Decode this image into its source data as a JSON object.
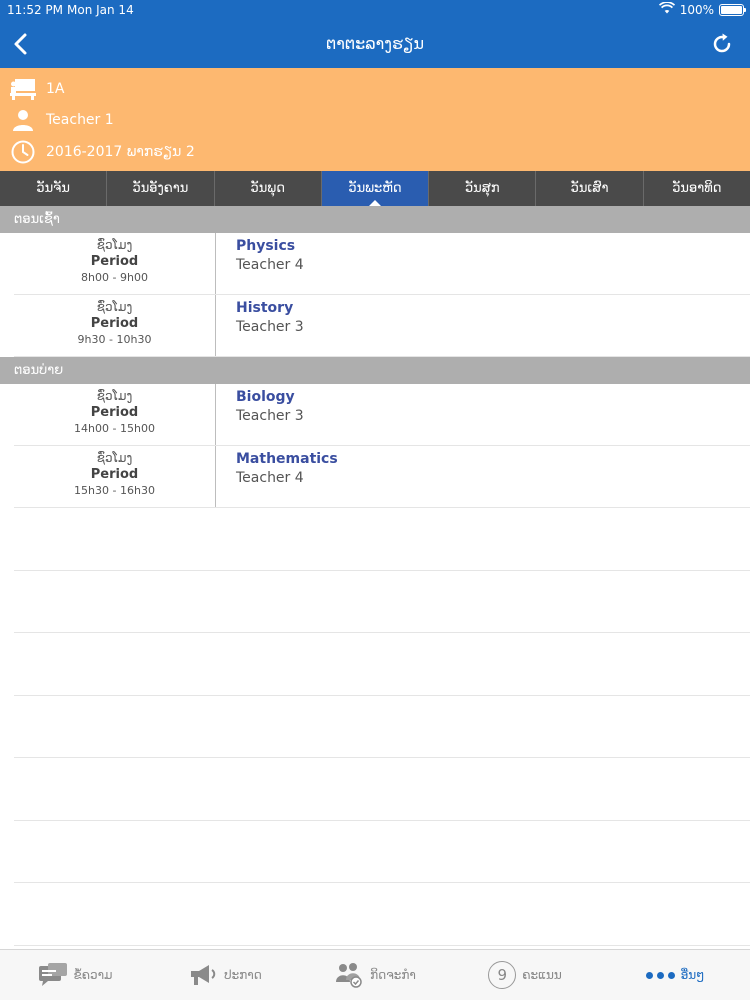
{
  "status_bar": {
    "time": "11:52 PM",
    "date": "Mon Jan 14",
    "battery": "100%"
  },
  "navbar": {
    "title": "ຕາຕະລາງຮຽນ"
  },
  "info": {
    "class_name": "1A",
    "teacher": "Teacher 1",
    "term": "2016-2017 ພາກຮຽນ 2"
  },
  "days": [
    "ວັນຈັນ",
    "ວັນອັງຄານ",
    "ວັນພຸດ",
    "ວັນພະຫັດ",
    "ວັນສຸກ",
    "ວັນເສົາ",
    "ວັນອາທິດ"
  ],
  "selected_day": "ວັນພະຫັດ",
  "sections": [
    {
      "title": "ຕອນເຊົ້າ",
      "items": [
        {
          "slot_label": "ຊົ່ວໂມງ",
          "period": "Period",
          "time": "8h00 - 9h00",
          "subject": "Physics",
          "teacher": "Teacher 4"
        },
        {
          "slot_label": "ຊົ່ວໂມງ",
          "period": "Period",
          "time": "9h30 - 10h30",
          "subject": "History",
          "teacher": "Teacher 3"
        }
      ]
    },
    {
      "title": "ຕອນບ່າຍ",
      "items": [
        {
          "slot_label": "ຊົ່ວໂມງ",
          "period": "Period",
          "time": "14h00 - 15h00",
          "subject": "Biology",
          "teacher": "Teacher 3"
        },
        {
          "slot_label": "ຊົ່ວໂມງ",
          "period": "Period",
          "time": "15h30 - 16h30",
          "subject": "Mathematics",
          "teacher": "Teacher 4"
        }
      ]
    }
  ],
  "tabbar": {
    "messages": "ຂໍ້ຄວາມ",
    "announcements": "ປະກາດ",
    "activities": "ກິດຈະກຳ",
    "scores": "ຄະແນນ",
    "score_badge": "9",
    "more": "ອື່ນໆ"
  },
  "colors": {
    "primary": "#1c6bc1",
    "info_panel": "#fdb870",
    "tab_bg": "#4a4a4a",
    "tab_active": "#2a5db0",
    "section_bg": "#aeaeae",
    "subject": "#3a4ea0"
  }
}
